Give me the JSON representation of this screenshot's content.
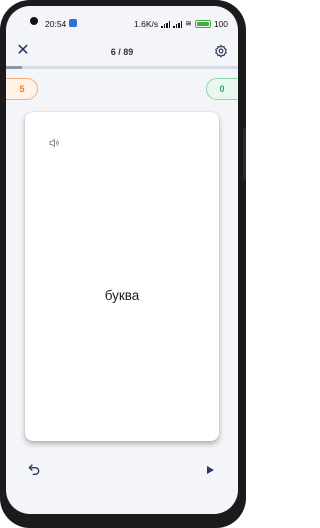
{
  "status_bar": {
    "time": "20:54",
    "network_speed": "1.6K/s",
    "battery": "100"
  },
  "header": {
    "close_icon": "close-icon",
    "progress_text": "6 / 89",
    "settings_icon": "gear-icon"
  },
  "progress": {
    "current": 6,
    "total": 89,
    "fraction": 0.067
  },
  "counters": {
    "still_learning": "5",
    "known": "0"
  },
  "card": {
    "audio_icon": "speaker-icon",
    "term": "буква"
  },
  "controls": {
    "undo_icon": "undo-icon",
    "play_icon": "play-icon"
  },
  "colors": {
    "still_learning": "#e67c26",
    "known": "#3aa55f",
    "icon": "#2b3a5c"
  }
}
